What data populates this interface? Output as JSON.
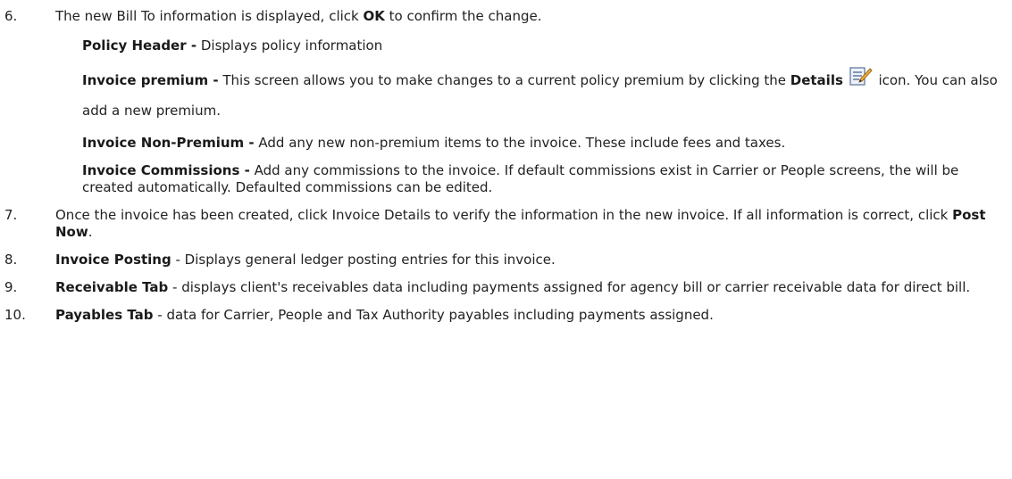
{
  "steps": [
    {
      "num": "6.",
      "pre": "The new Bill To information is displayed, click ",
      "bold": "OK",
      "post": " to confirm the change."
    },
    {
      "num": "7.",
      "pre": "Once the invoice has been created, click Invoice Details to verify the information in the new invoice.  If all information is correct, click ",
      "bold": "Post Now",
      "post": "."
    },
    {
      "num": "8.",
      "bold": "Invoice Posting",
      "post": " - Displays general ledger posting entries for this invoice."
    },
    {
      "num": "9.",
      "bold": "Receivable Tab",
      "post": " - displays client's receivables data including payments assigned for agency bill or carrier receivable data for direct bill."
    },
    {
      "num": "10.",
      "bold": "Payables Tab",
      "post": " - data for Carrier, People and Tax Authority payables including payments assigned."
    }
  ],
  "subs": {
    "policy_header": {
      "bold": "Policy Header -",
      "text": " Displays policy information"
    },
    "invoice_premium": {
      "bold": "Invoice premium -",
      "text1": " This screen allows you to make changes to a current policy premium by clicking the ",
      "details": "Details",
      "text2": " icon. You can also add a new premium.",
      "icon": "edit-details-icon"
    },
    "invoice_non_premium": {
      "bold": "Invoice Non-Premium -",
      "text": " Add any new non-premium items to the invoice. These include fees and taxes."
    },
    "invoice_commissions": {
      "bold": "Invoice Commissions -",
      "text": " Add any commissions to the invoice. If default commissions exist in Carrier or People screens, the will be created automatically. Defaulted commissions can be edited."
    }
  }
}
